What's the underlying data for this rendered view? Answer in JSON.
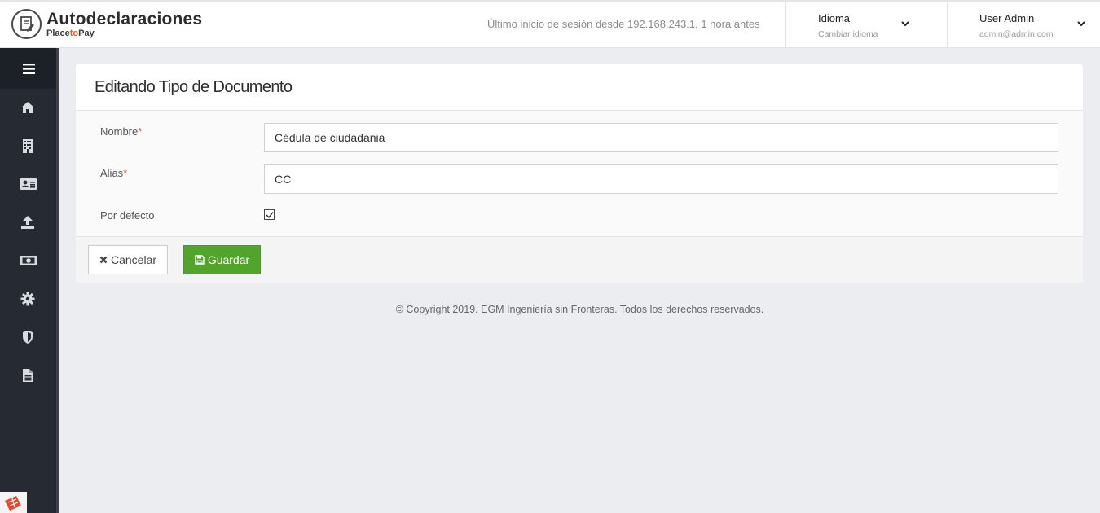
{
  "header": {
    "app_title": "Autodeclaraciones",
    "brand_sub_a": "Place",
    "brand_sub_b": "to",
    "brand_sub_c": "Pay",
    "last_login": "Último inicio de sesión desde 192.168.243.1, 1 hora antes",
    "language": {
      "title": "Idioma",
      "subtitle": "Cambiar idioma"
    },
    "user": {
      "name": "User Admin",
      "email": "admin@admin.com"
    }
  },
  "sidebar": {
    "items": [
      {
        "icon": "home-icon"
      },
      {
        "icon": "building-icon"
      },
      {
        "icon": "id-card-icon"
      },
      {
        "icon": "upload-icon"
      },
      {
        "icon": "money-icon"
      },
      {
        "icon": "gear-icon"
      },
      {
        "icon": "shield-icon"
      },
      {
        "icon": "file-text-icon"
      }
    ]
  },
  "panel": {
    "title": "Editando Tipo de Documento",
    "fields": {
      "nombre": {
        "label": "Nombre",
        "required_mark": "*",
        "value": "Cédula de ciudadania"
      },
      "alias": {
        "label": "Alias",
        "required_mark": "*",
        "value": "CC"
      },
      "por_defecto": {
        "label": "Por defecto",
        "checked": true
      }
    },
    "buttons": {
      "cancel": "Cancelar",
      "save": "Guardar"
    }
  },
  "footer": {
    "copyright": "© Copyright 2019. EGM Ingeniería sin Fronteras. Todos los derechos reservados."
  },
  "colors": {
    "sidebar_bg": "#252a33",
    "save_button": "#52a52a",
    "required": "#d9534f",
    "brand_accent": "#f05a28"
  }
}
